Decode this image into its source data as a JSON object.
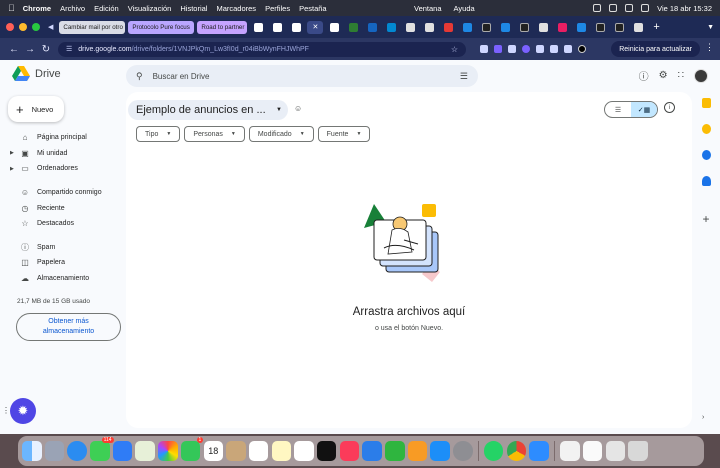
{
  "menubar": {
    "app": "Chrome",
    "items": [
      "Archivo",
      "Edición",
      "Visualización",
      "Historial",
      "Marcadores",
      "Perfiles",
      "Pestaña"
    ],
    "center": [
      "Ventana",
      "Ayuda"
    ],
    "clock": "Vie 18 abr 15:32"
  },
  "tabs": {
    "t1": "Cambiar mail por otro",
    "t2": "Protocolo Pure focus",
    "t3": "Road to partner"
  },
  "toolbar": {
    "url_host": "drive.google.com",
    "url_path": "/drive/folders/1VNJPkQm_Lw3fI0d_r04iBbWynFHJWhPF",
    "update_label": "Reinicia para actualizar"
  },
  "drive": {
    "logo_text": "Drive",
    "search_placeholder": "Buscar en Drive",
    "new_label": "Nuevo",
    "nav": {
      "home": "Página principal",
      "my_unit": "Mi unidad",
      "computers": "Ordenadores",
      "shared": "Compartido conmigo",
      "recent": "Reciente",
      "starred": "Destacados",
      "spam": "Spam",
      "trash": "Papelera",
      "storage": "Almacenamiento"
    },
    "storage_used": "21,7 MB de 15 GB usado",
    "more_storage": "Obtener más almacenamiento",
    "folder_title": "Ejemplo de anuncios en ...",
    "filters": {
      "type": "Tipo",
      "people": "Personas",
      "modified": "Modificado",
      "source": "Fuente"
    },
    "empty_title": "Arrastra archivos aquí",
    "empty_subtitle": "o usa el botón Nuevo."
  },
  "colors": {
    "accent": "#0b57d0",
    "view_selected": "#c2e7ff",
    "tabstrip": "#1e2a55",
    "toolbar": "#2c3763"
  },
  "dock_apps": [
    "finder-icon",
    "launchpad-icon",
    "safari-icon",
    "messages-icon",
    "mail-icon",
    "maps-icon",
    "photos-icon",
    "facetime-icon",
    "calendar-icon",
    "contacts-icon",
    "reminders-icon",
    "notes-icon",
    "freeform-icon",
    "appletv-icon",
    "music-icon",
    "keynote-icon",
    "numbers-icon",
    "pages-icon",
    "appstore-icon",
    "settings-icon",
    "whatsapp-icon",
    "chrome-icon",
    "zoom-icon",
    "preview-icon",
    "textedit-icon",
    "keyboard-icon",
    "trash-icon"
  ],
  "dock_badges": {
    "messages": "114",
    "facetime": "1",
    "calendar_day": "18"
  }
}
